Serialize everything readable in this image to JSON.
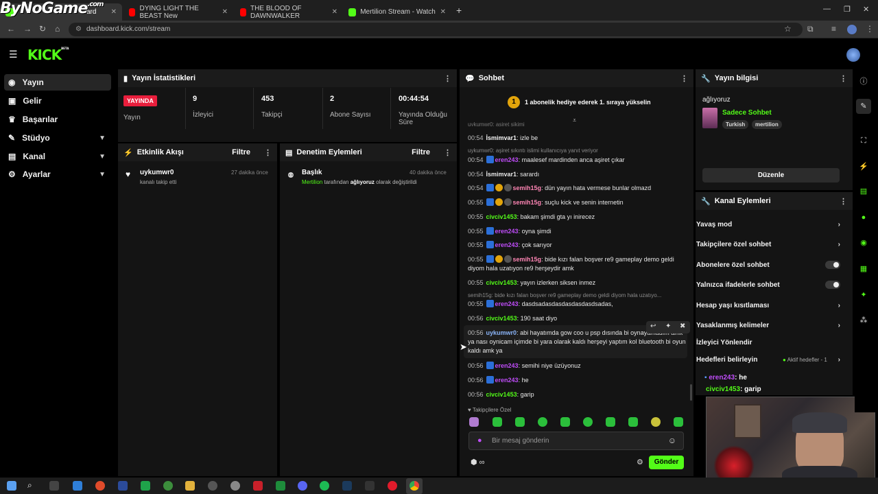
{
  "browser": {
    "watermark": "ByNoGame",
    "watermark_sub": ".com",
    "tabs": [
      {
        "title": "ard",
        "icon": "kick-favicon"
      },
      {
        "title": "DYING LIGHT THE BEAST New",
        "icon": "youtube-favicon"
      },
      {
        "title": "THE BLOOD OF DAWNWALKER",
        "icon": "youtube-favicon"
      },
      {
        "title": "Mertilion Stream - Watch Live o",
        "icon": "kick-favicon"
      }
    ],
    "url": "dashboard.kick.com/stream"
  },
  "app": {
    "logo": "KICK",
    "logo_beta": "BETA"
  },
  "sidebar": {
    "items": [
      {
        "label": "Yayın",
        "icon": "broadcast-icon"
      },
      {
        "label": "Gelir",
        "icon": "revenue-icon"
      },
      {
        "label": "Başarılar",
        "icon": "trophy-icon"
      },
      {
        "label": "Stüdyo",
        "icon": "studio-icon"
      },
      {
        "label": "Kanal",
        "icon": "channel-icon"
      },
      {
        "label": "Ayarlar",
        "icon": "gear-icon"
      }
    ]
  },
  "stats": {
    "title": "Yayın İstatistikleri",
    "live_badge": "YAYINDA",
    "live_label": "Yayın",
    "viewers_value": "9",
    "viewers_label": "İzleyici",
    "followers_value": "453",
    "followers_label": "Takipçi",
    "subs_value": "2",
    "subs_label": "Abone Sayısı",
    "uptime_value": "00:44:54",
    "uptime_label": "Yayında Olduğu Süre"
  },
  "activity": {
    "title": "Etkinlik Akışı",
    "filter": "Filtre",
    "user": "uykumwr0",
    "action": "kanalı takip etti",
    "time": "27 dakika önce"
  },
  "moderation": {
    "title": "Denetim Eylemleri",
    "filter": "Filtre",
    "heading": "Başlık",
    "by": "Mertilion",
    "text1": "tarafından",
    "value": "ağlıyoruz",
    "text2": "olarak değiştirildi",
    "time": "40 dakika önce"
  },
  "chat": {
    "title": "Sohbet",
    "banner_num": "1",
    "banner": "1 abonelik hediye ederek 1. sıraya yükselin",
    "top_cut": "uykumwr0: aşiret sikimi",
    "messages": [
      {
        "time": "00:54",
        "user": "İsmimvar1",
        "text": "izle be",
        "color": "#f4f4f4"
      },
      {
        "time": "00:54",
        "user": "eren243",
        "text": "maalesef mardinden anca aşiret çıkar",
        "color": "#c04dfa"
      },
      {
        "time": "00:54",
        "user": "İsmimvar1",
        "text": "sarardı",
        "color": "#f4f4f4"
      },
      {
        "time": "00:54",
        "user": "semih15g",
        "text": "dün yayın hata vermese bunlar olmazd",
        "color": "#ff85b4"
      },
      {
        "time": "00:55",
        "user": "semih15g",
        "text": "suçlu kick ve senin internetin",
        "color": "#ff85b4"
      },
      {
        "time": "00:55",
        "user": "civciv1453",
        "text": "bakam şimdi gta yı inirecez",
        "color": "#53fc18"
      },
      {
        "time": "00:55",
        "user": "eren243",
        "text": "oyna şimdi",
        "color": "#c04dfa"
      },
      {
        "time": "00:55",
        "user": "eren243",
        "text": "çok sarıyor",
        "color": "#c04dfa"
      },
      {
        "time": "00:55",
        "user": "semih15g",
        "text": "bide kızı falan boşver re9 gameplay demo geldi diyom hala uzatıyon re9 herşeydir amk",
        "color": "#ff85b4"
      },
      {
        "time": "00:55",
        "user": "civciv1453",
        "text": "yayın izlerken siksen inmez",
        "color": "#53fc18"
      },
      {
        "time": "00:55",
        "user": "eren243",
        "text": "dasdsadasdasdasdasdasdsadas,",
        "color": "#c04dfa"
      },
      {
        "time": "00:56",
        "user": "civciv1453",
        "text": "190 saat diyo",
        "color": "#53fc18"
      },
      {
        "time": "00:56",
        "user": "uykumwr0",
        "text": "abi hayatımda gow coo u psp dısında bi oynayamadım amk ya nası oynicam içimde bi yara olarak kaldı herşeyi yaptım kol bluetooth bi oyun kaldı amk ya",
        "color": "#8ab4f8"
      },
      {
        "time": "00:56",
        "user": "eren243",
        "text": "semihi niye üzüyonuz",
        "color": "#c04dfa"
      },
      {
        "time": "00:56",
        "user": "eren243",
        "text": "he",
        "color": "#c04dfa"
      },
      {
        "time": "00:56",
        "user": "civciv1453",
        "text": "garip",
        "color": "#53fc18"
      }
    ],
    "reply1": "uykumwr0: aşiret sıkıntı islimi kullanıcıya yanıt veriyor",
    "reply2": "semih15g: bide kızı falan boşver re9 gameplay demo geldi diyom hala uzatıyo...",
    "followers_only": "Takipçilere Özel",
    "placeholder": "Bir mesaj gönderin",
    "send": "Gönder",
    "infinity": "∞"
  },
  "stream_info": {
    "title": "Yayın bilgisi",
    "stream_title": "ağlıyoruz",
    "category": "Sadece Sohbet",
    "tag1": "Turkish",
    "tag2": "mertilion",
    "edit": "Düzenle"
  },
  "channel_actions": {
    "title": "Kanal Eylemleri",
    "items": [
      {
        "label": "Yavaş mod",
        "kind": "chevron"
      },
      {
        "label": "Takipçilere özel sohbet",
        "kind": "chevron"
      },
      {
        "label": "Abonelere özel sohbet",
        "kind": "toggle"
      },
      {
        "label": "Yalnızca ifadelerle sohbet",
        "kind": "toggle"
      },
      {
        "label": "Hesap yaşı kısıtlaması",
        "kind": "chevron"
      },
      {
        "label": "Yasaklanmış kelimeler",
        "kind": "chevron"
      },
      {
        "label": "İzleyici Yönlendir",
        "kind": "none"
      },
      {
        "label": "Hedefleri belirleyin",
        "kind": "chevron"
      }
    ],
    "active_goals": "Aktif hedefler - 1"
  },
  "overlay_chat": [
    {
      "user": "eren243",
      "text": ": he",
      "color": "#c04dfa"
    },
    {
      "user": "civciv1453",
      "text": ": garip",
      "color": "#53fc18"
    }
  ],
  "colors": {
    "accent": "#53fc18",
    "live": "#e91e3c",
    "panel": "#141414"
  }
}
